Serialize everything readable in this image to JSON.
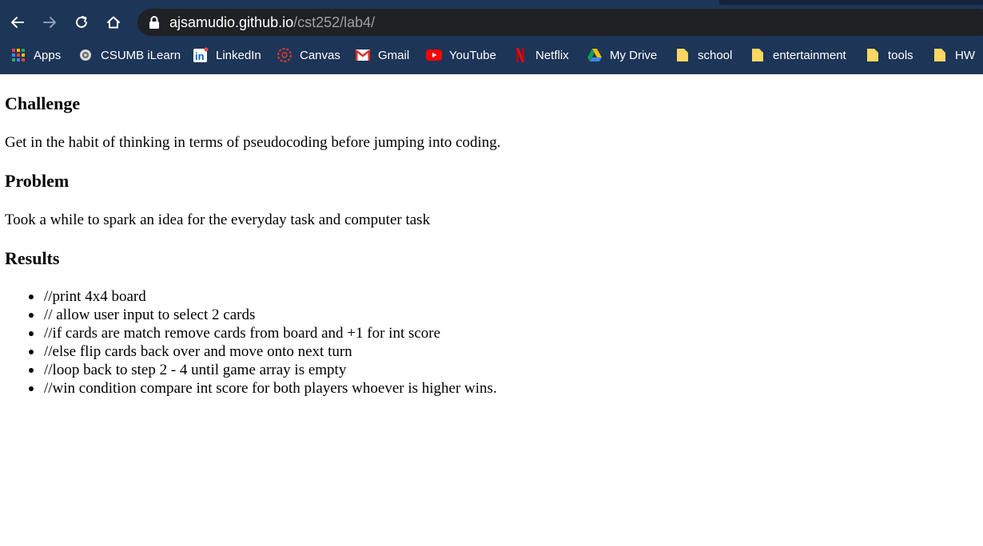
{
  "browser": {
    "url_host": "ajsamudio.github.io",
    "url_path": "/cst252/lab4/",
    "bookmarks": [
      {
        "label": "Apps",
        "icon": "apps-grid-icon"
      },
      {
        "label": "CSUMB iLearn",
        "icon": "ilearn-icon"
      },
      {
        "label": "LinkedIn",
        "icon": "linkedin-icon"
      },
      {
        "label": "Canvas",
        "icon": "canvas-icon"
      },
      {
        "label": "Gmail",
        "icon": "gmail-icon"
      },
      {
        "label": "YouTube",
        "icon": "youtube-icon"
      },
      {
        "label": "Netflix",
        "icon": "netflix-icon"
      },
      {
        "label": "My Drive",
        "icon": "google-drive-icon"
      },
      {
        "label": "school",
        "icon": "folder-icon"
      },
      {
        "label": "entertainment",
        "icon": "folder-icon"
      },
      {
        "label": "tools",
        "icon": "folder-icon"
      },
      {
        "label": "HW",
        "icon": "folder-icon"
      }
    ],
    "colors": {
      "chrome_bg": "#1d3557",
      "omnibox_bg": "#202124"
    }
  },
  "page": {
    "sections": [
      {
        "heading": "Challenge",
        "text": "Get in the habit of thinking in terms of pseudocoding before jumping into coding."
      },
      {
        "heading": "Problem",
        "text": "Took a while to spark an idea for the everyday task and computer task"
      },
      {
        "heading": "Results"
      }
    ],
    "results": [
      "//print 4x4 board",
      "// allow user input to select 2 cards",
      "//if cards are match remove cards from board and +1 for int score",
      "//else flip cards back over and move onto next turn",
      "//loop back to step 2 - 4 until game array is empty",
      "//win condition compare int score for both players whoever is higher wins."
    ]
  }
}
